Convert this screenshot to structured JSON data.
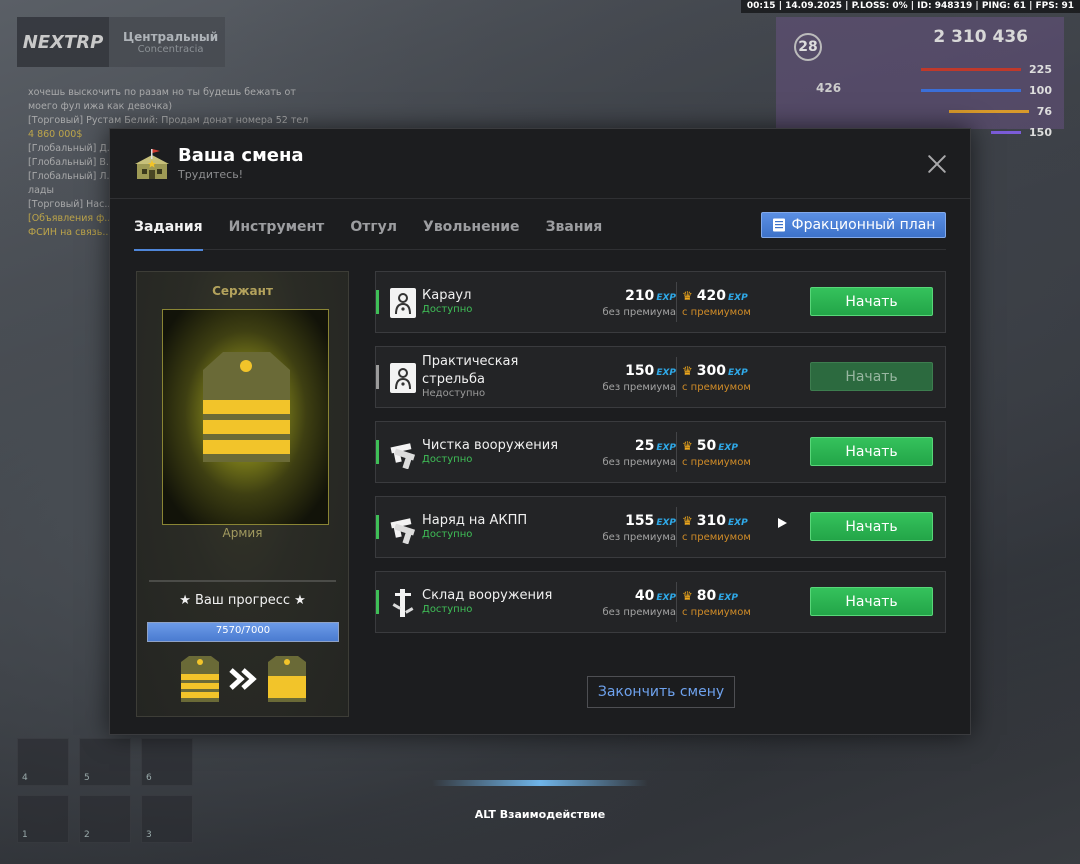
{
  "hud": {
    "top_status": "00:15 | 14.09.2025 | P.LOSS: 0% | ID: 948319 | PING: 61 | FPS: 91",
    "logo": "NEXTRP",
    "server_name": "Центральный",
    "server_sub": "Concentracia",
    "level": "28",
    "money": "2 310 436",
    "stat_426": "426",
    "stats": [
      "225",
      "100",
      "76",
      "150"
    ],
    "chat": [
      "хочешь выскочить по разам но ты будешь бежать от",
      "моего фул ижа как девочка)",
      "[Торговый] Рустам Белий: Продам донат номера 52 тел",
      "4 860 000$",
      "[Глобальный] Д...",
      "[Глобальный] В...",
      "[Глобальный] Л...",
      "лады",
      "[Торговый] Нас...",
      "[Объявления ф...",
      "ФСИН на связь..."
    ],
    "slots": [
      "4",
      "5",
      "6",
      "1",
      "2",
      "3"
    ],
    "alt_hint": "ALT Взаимодействие"
  },
  "modal": {
    "title": "Ваша смена",
    "subtitle": "Трудитесь!",
    "tabs": [
      "Задания",
      "Инструмент",
      "Отгул",
      "Увольнение",
      "Звания"
    ],
    "plan_button": "Фракционный план",
    "finish_button": "Закончить смену"
  },
  "rank": {
    "name": "Сержант",
    "branch": "Армия",
    "progress_title": "★ Ваш прогресс ★",
    "progress_text": "7570/7000",
    "progress_fraction": 1.0,
    "accent_color": "#f2c42a"
  },
  "tasks": [
    {
      "name": "Караул",
      "status": "Доступно",
      "exp": "210",
      "premium_exp": "420",
      "button": "Начать",
      "icon": "shooting-target-icon",
      "available": true
    },
    {
      "name": "Практическая стрельба",
      "status": "Недоступно",
      "exp": "150",
      "premium_exp": "300",
      "button": "Начать",
      "icon": "shooting-target-icon",
      "available": false
    },
    {
      "name": "Чистка вооружения",
      "status": "Доступно",
      "exp": "25",
      "premium_exp": "50",
      "button": "Начать",
      "icon": "pistols-icon",
      "available": true
    },
    {
      "name": "Наряд на АКПП",
      "status": "Доступно",
      "exp": "155",
      "premium_exp": "310",
      "button": "Начать",
      "icon": "pistols-icon",
      "available": true
    },
    {
      "name": "Склад вооружения",
      "status": "Доступно",
      "exp": "40",
      "premium_exp": "80",
      "button": "Начать",
      "icon": "weapon-rack-icon",
      "available": true
    }
  ],
  "labels": {
    "exp_tag": "EXP",
    "without_premium": "без премиума",
    "with_premium": "с премиумом"
  },
  "colors": {
    "accent_blue": "#4f86d9",
    "start_green": "#2fb552",
    "available_green": "#3fbf57",
    "exp_blue": "#2fa9e8",
    "premium_orange": "#d08c28"
  }
}
